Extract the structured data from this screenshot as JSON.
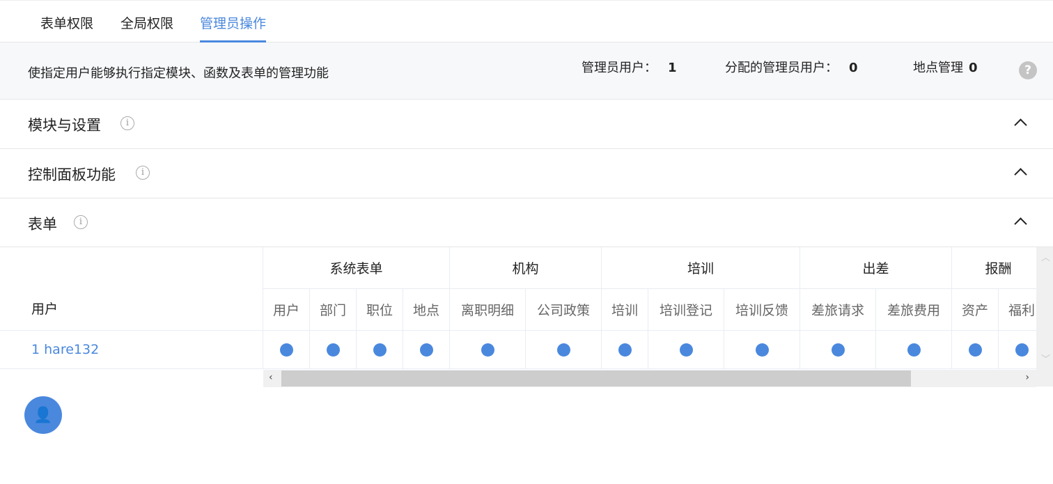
{
  "tabs": [
    {
      "label": "表单权限"
    },
    {
      "label": "全局权限"
    },
    {
      "label": "管理员操作"
    }
  ],
  "info": {
    "description": "使指定用户能够执行指定模块、函数及表单的管理功能",
    "admin_users_label": "管理员用户：",
    "admin_users": "1",
    "assigned_admin_label": "分配的管理员用户：",
    "assigned_admin": "0",
    "location_mgmt_label": "地点管理",
    "location_mgmt": "0",
    "help": "?"
  },
  "sections": [
    {
      "title": "模块与设置"
    },
    {
      "title": "控制面板功能"
    },
    {
      "title": "表单"
    }
  ],
  "table": {
    "user_header": "用户",
    "groups": [
      "系统表单",
      "机构",
      "培训",
      "出差",
      "报酬"
    ],
    "columns": [
      "用户",
      "部门",
      "职位",
      "地点",
      "离职明细",
      "公司政策",
      "培训",
      "培训登记",
      "培训反馈",
      "差旅请求",
      "差旅费用",
      "资产",
      "福利"
    ],
    "rows": [
      {
        "user": "1 hare132",
        "enabled": [
          true,
          true,
          true,
          true,
          true,
          true,
          true,
          true,
          true,
          true,
          true,
          true,
          true
        ]
      }
    ]
  },
  "colors": {
    "accent": "#4a88de"
  }
}
